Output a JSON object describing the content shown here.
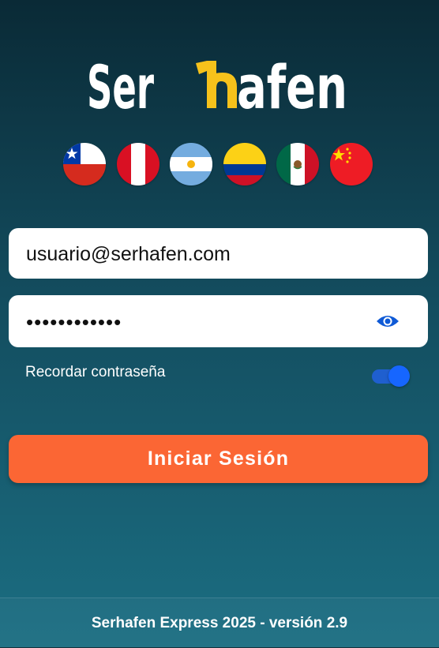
{
  "brand": {
    "logo_text": "Serhafen",
    "accent_color": "#f6c21b",
    "primary_color": "#ffffff"
  },
  "countries": [
    {
      "name": "chile",
      "icon": "chile-flag-icon"
    },
    {
      "name": "peru",
      "icon": "peru-flag-icon"
    },
    {
      "name": "argentina",
      "icon": "argentina-flag-icon"
    },
    {
      "name": "colombia",
      "icon": "colombia-flag-icon"
    },
    {
      "name": "mexico",
      "icon": "mexico-flag-icon"
    },
    {
      "name": "china",
      "icon": "china-flag-icon"
    }
  ],
  "login": {
    "email_value": "usuario@serhafen.com",
    "password_value": "••••••••••••",
    "show_password_icon": "eye-icon",
    "remember_label": "Recordar contraseña",
    "remember_enabled": true,
    "submit_label": "Iniciar Sesión",
    "submit_color": "#fb6634"
  },
  "footer": {
    "text": "Serhafen Express 2025 - versión 2.9"
  }
}
